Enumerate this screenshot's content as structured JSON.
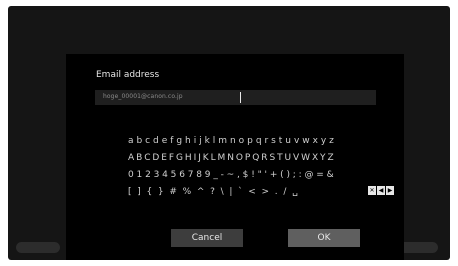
{
  "dialog": {
    "title": "Email address",
    "field_value": "hoge_00001@canon.co.jp"
  },
  "keyboard": {
    "rows": [
      [
        "a",
        "b",
        "c",
        "d",
        "e",
        "f",
        "g",
        "h",
        "i",
        "j",
        "k",
        "l",
        "m",
        "n",
        "o",
        "p",
        "q",
        "r",
        "s",
        "t",
        "u",
        "v",
        "w",
        "x",
        "y",
        "z"
      ],
      [
        "A",
        "B",
        "C",
        "D",
        "E",
        "F",
        "G",
        "H",
        "I",
        "J",
        "K",
        "L",
        "M",
        "N",
        "O",
        "P",
        "Q",
        "R",
        "S",
        "T",
        "U",
        "V",
        "W",
        "X",
        "Y",
        "Z"
      ],
      [
        "0",
        "1",
        "2",
        "3",
        "4",
        "5",
        "6",
        "7",
        "8",
        "9",
        "_",
        "-",
        "~",
        ",",
        "$",
        "!",
        "\"",
        "'",
        "+",
        "(",
        ")",
        ";",
        ":",
        "@",
        "=",
        "&"
      ],
      [
        "[",
        "]",
        "{",
        "}",
        "#",
        "%",
        "^",
        "?",
        "\\",
        "|",
        "`",
        "<",
        ">",
        ".",
        "/",
        "␣"
      ]
    ],
    "special_keys": [
      "delete-icon",
      "left-arrow-icon",
      "right-arrow-icon"
    ]
  },
  "buttons": {
    "cancel": "Cancel",
    "ok": "OK"
  }
}
